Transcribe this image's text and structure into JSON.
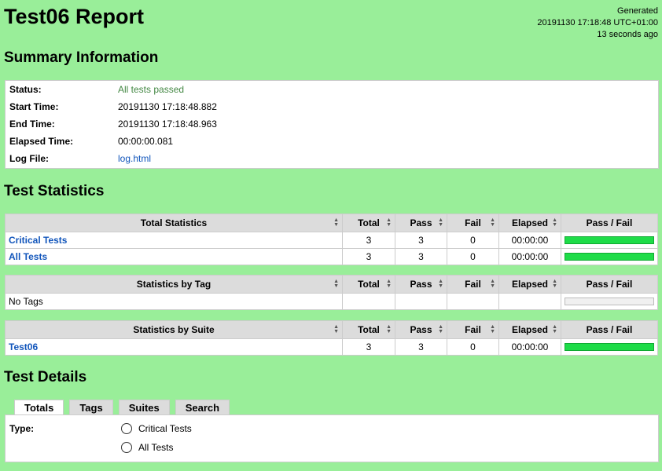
{
  "header": {
    "title": "Test06 Report",
    "generated_label": "Generated",
    "generated_time": "20191130 17:18:48 UTC+01:00",
    "generated_ago": "13 seconds ago"
  },
  "summary": {
    "heading": "Summary Information",
    "rows": [
      {
        "label": "Status:",
        "value": "All tests passed"
      },
      {
        "label": "Start Time:",
        "value": "20191130 17:18:48.882"
      },
      {
        "label": "End Time:",
        "value": "20191130 17:18:48.963"
      },
      {
        "label": "Elapsed Time:",
        "value": "00:00:00.081"
      },
      {
        "label": "Log File:",
        "value": "log.html"
      }
    ]
  },
  "statistics": {
    "heading": "Test Statistics",
    "columns": [
      "Total",
      "Pass",
      "Fail",
      "Elapsed",
      "Pass / Fail"
    ],
    "total": {
      "title": "Total Statistics",
      "rows": [
        {
          "name": "Critical Tests",
          "total": "3",
          "pass": "3",
          "fail": "0",
          "elapsed": "00:00:00",
          "pass_fraction": 1.0
        },
        {
          "name": "All Tests",
          "total": "3",
          "pass": "3",
          "fail": "0",
          "elapsed": "00:00:00",
          "pass_fraction": 1.0
        }
      ]
    },
    "tag": {
      "title": "Statistics by Tag",
      "rows": [
        {
          "name": "No Tags",
          "total": "",
          "pass": "",
          "fail": "",
          "elapsed": "",
          "pass_fraction": 0
        }
      ]
    },
    "suite": {
      "title": "Statistics by Suite",
      "rows": [
        {
          "name": "Test06",
          "total": "3",
          "pass": "3",
          "fail": "0",
          "elapsed": "00:00:00",
          "pass_fraction": 1.0
        }
      ]
    }
  },
  "details": {
    "heading": "Test Details",
    "tabs": [
      "Totals",
      "Tags",
      "Suites",
      "Search"
    ],
    "active_tab": "Totals",
    "type_label": "Type:",
    "options": [
      "Critical Tests",
      "All Tests"
    ]
  },
  "colors": {
    "background": "#99ee99",
    "pass_bar": "#1edc48",
    "link": "#1155bb"
  }
}
